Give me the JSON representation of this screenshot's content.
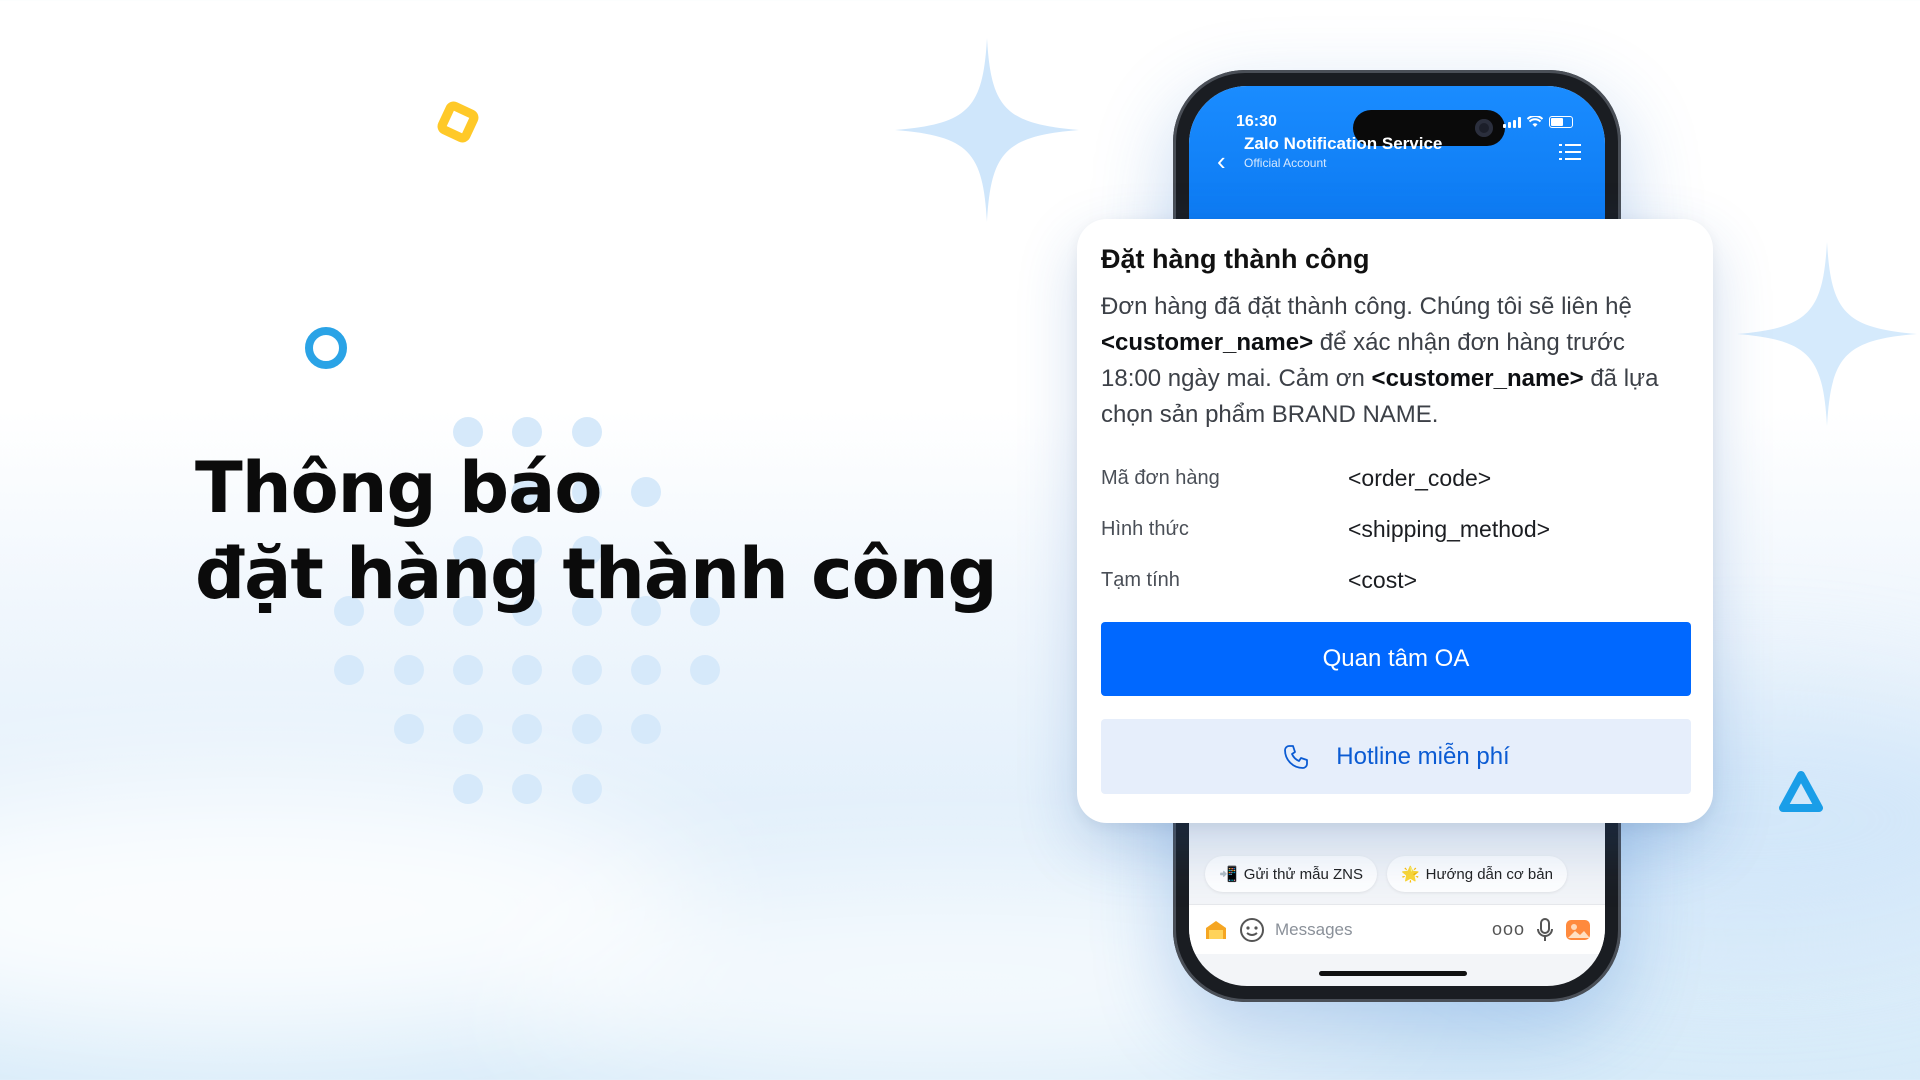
{
  "headline": {
    "line1": "Thông báo",
    "line2": "đặt hàng thành công"
  },
  "phone": {
    "status_time": "16:30",
    "oa_name": "Zalo Notification Service",
    "oa_subtitle": "Official Account",
    "quick_replies": [
      {
        "icon": "phone-send-icon",
        "label": "Gửi thử mẫu ZNS"
      },
      {
        "icon": "sparkle-icon",
        "label": "Hướng dẫn cơ bản"
      }
    ],
    "input_placeholder": "Messages"
  },
  "card": {
    "title": "Đặt hàng thành công",
    "body": {
      "part1": "Đơn hàng đã đặt thành công. Chúng tôi sẽ liên hệ ",
      "name1": "<customer_name>",
      "part2": " để xác nhận đơn hàng trước 18:00 ngày mai. Cảm ơn ",
      "name2": "<customer_name>",
      "part3": " đã lựa chọn sản phẩm BRAND NAME."
    },
    "fields": [
      {
        "key": "Mã đơn hàng",
        "value": "<order_code>"
      },
      {
        "key": "Hình thức",
        "value": "<shipping_method>"
      },
      {
        "key": "Tạm tính",
        "value": "<cost>"
      }
    ],
    "primary_button": "Quan tâm OA",
    "secondary_button": "Hotline miễn phí"
  },
  "colors": {
    "zalo_blue": "#0068ff",
    "header_blue": "#1a8cff",
    "secondary_bg": "#e6eefb",
    "deco_yellow": "#ffc928",
    "deco_blue": "#2aa3e6",
    "dot_blue": "#d6e9fa"
  }
}
